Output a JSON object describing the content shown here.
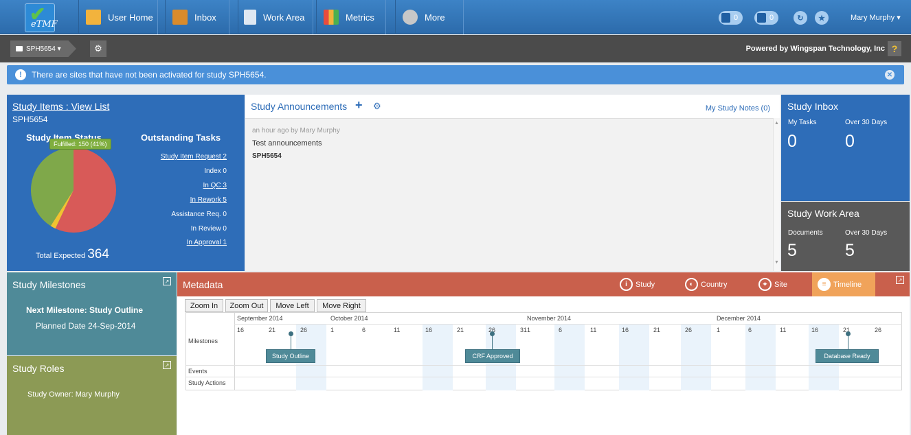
{
  "topbar": {
    "logo_text": "eTMF",
    "nav": [
      {
        "label": "User Home",
        "icon": "house-icon"
      },
      {
        "label": "Inbox",
        "icon": "inbox-icon"
      },
      {
        "label": "Work Area",
        "icon": "document-icon"
      },
      {
        "label": "Metrics",
        "icon": "bar-chart-icon"
      },
      {
        "label": "More",
        "icon": "gear-icon"
      }
    ],
    "badge1": "0",
    "badge2": "0",
    "user": "Mary Murphy"
  },
  "subbar": {
    "study": "SPH5654",
    "powered": "Powered by Wingspan Technology, Inc",
    "help": "?"
  },
  "alert": {
    "text": "There are sites that have not been activated for study SPH5654."
  },
  "study_items": {
    "title": "Study Items : View List",
    "study": "SPH5654",
    "status_title": "Study Item Status",
    "tooltip": "Fulfilled: 150 (41%)",
    "tasks_title": "Outstanding Tasks",
    "tasks": [
      {
        "label": "Study Item Request 2",
        "link": true
      },
      {
        "label": "Index 0",
        "link": false
      },
      {
        "label": "In QC 3",
        "link": true
      },
      {
        "label": "In Rework 5",
        "link": true
      },
      {
        "label": "Assistance Req. 0",
        "link": false
      },
      {
        "label": "In Review 0",
        "link": false
      },
      {
        "label": "In Approval 1",
        "link": true
      }
    ],
    "total_label": "Total Expected",
    "total_value": "364",
    "pie_fractions": {
      "fulfilled": 0.41,
      "other": 0.02,
      "remaining": 0.57
    },
    "pie_colors": {
      "fulfilled": "#7fa84a",
      "other": "#f2c230",
      "remaining": "#d85a58"
    }
  },
  "announcements": {
    "title": "Study Announcements",
    "notes": "My Study Notes (0)",
    "meta": "an hour ago by Mary Murphy",
    "text": "Test announcements",
    "study": "SPH5654"
  },
  "inbox": {
    "title": "Study Inbox",
    "l1": "My Tasks",
    "v1": "0",
    "l2": "Over 30 Days",
    "v2": "0"
  },
  "workarea": {
    "title": "Study Work Area",
    "l1": "Documents",
    "v1": "5",
    "l2": "Over 30 Days",
    "v2": "5"
  },
  "milestones": {
    "title": "Study Milestones",
    "next": "Next Milestone: Study Outline",
    "planned": "Planned Date 24-Sep-2014"
  },
  "roles": {
    "title": "Study Roles",
    "owner": "Study Owner: Mary Murphy"
  },
  "metadata": {
    "title": "Metadata",
    "tabs": [
      "Study",
      "Country",
      "Site",
      "Timeline"
    ],
    "buttons": [
      "Zoom In",
      "Zoom Out",
      "Move Left",
      "Move Right"
    ],
    "months": [
      "September 2014",
      "October 2014",
      "November 2014",
      "December 2014"
    ],
    "days": [
      "16",
      "21",
      "26",
      "1",
      "6",
      "11",
      "16",
      "21",
      "26",
      "31",
      "1",
      "6",
      "11",
      "16",
      "21",
      "26",
      "1",
      "6",
      "11",
      "16",
      "21",
      "26"
    ],
    "rows": [
      "Milestones",
      "Events",
      "Study Actions"
    ],
    "milestones": [
      "Study Outline",
      "CRF Approved",
      "Database Ready"
    ]
  }
}
